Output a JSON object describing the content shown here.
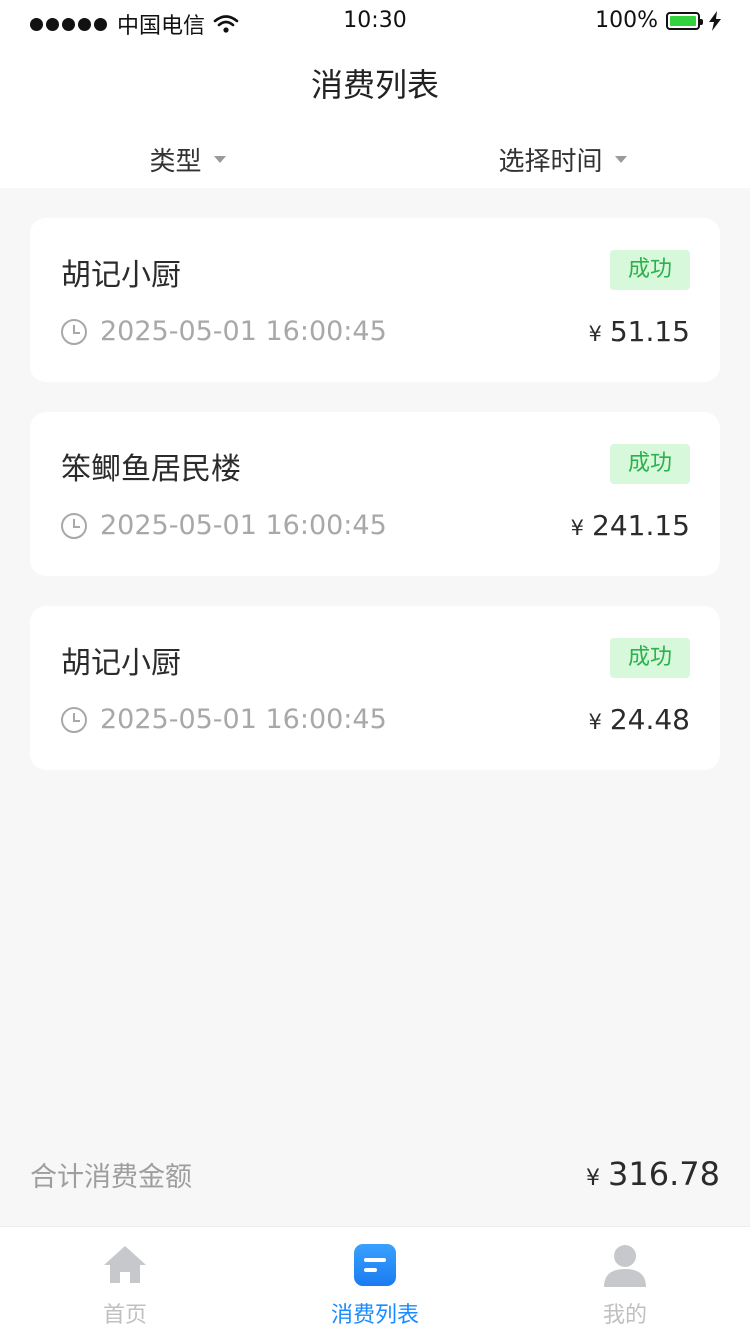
{
  "status_bar": {
    "carrier": "中国电信",
    "time": "10:30",
    "battery": "100%"
  },
  "nav": {
    "title": "消费列表"
  },
  "filters": {
    "type_label": "类型",
    "time_label": "选择时间"
  },
  "records": [
    {
      "name": "胡记小厨",
      "status": "成功",
      "time": "2025-05-01 16:00:45",
      "currency": "¥",
      "amount": "51.15"
    },
    {
      "name": "笨鲫鱼居民楼",
      "status": "成功",
      "time": "2025-05-01 16:00:45",
      "currency": "¥",
      "amount": "241.15"
    },
    {
      "name": "胡记小厨",
      "status": "成功",
      "time": "2025-05-01 16:00:45",
      "currency": "¥",
      "amount": "24.48"
    }
  ],
  "total": {
    "label": "合计消费金额",
    "currency": "¥",
    "amount": "316.78"
  },
  "tabs": [
    {
      "label": "首页",
      "icon": "home-icon",
      "active": false
    },
    {
      "label": "消费列表",
      "icon": "list-icon",
      "active": true
    },
    {
      "label": "我的",
      "icon": "user-icon",
      "active": false
    }
  ],
  "colors": {
    "accent": "#1a8cff",
    "success_text": "#2bb24c",
    "success_bg": "#d7f8da",
    "background": "#f7f7f7"
  }
}
